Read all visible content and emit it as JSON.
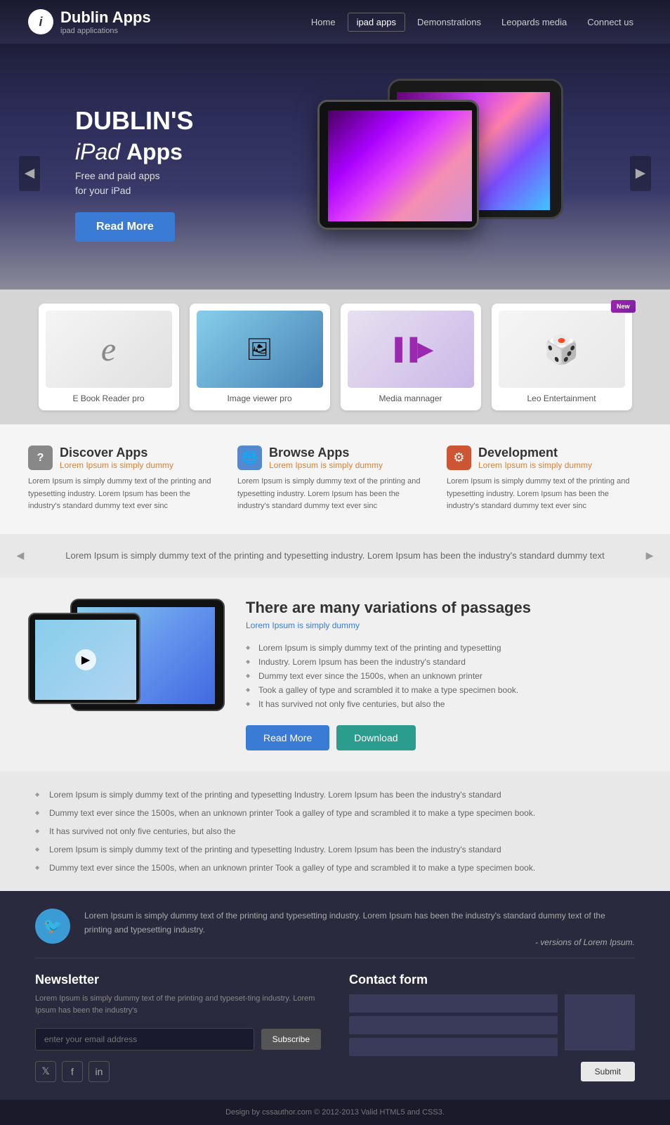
{
  "header": {
    "logo_icon": "i",
    "logo_title": "Dublin Apps",
    "logo_subtitle": "ipad applications",
    "nav": {
      "home": "Home",
      "ipad_apps": "ipad apps",
      "demonstrations": "Demonstrations",
      "leopards_media": "Leopards media",
      "connect_us": "Connect us"
    }
  },
  "hero": {
    "title_line1": "DUBLIN'S",
    "title_line2_italic": "iPad",
    "title_line2_bold": "Apps",
    "description": "Free and paid apps\nfor your iPad",
    "read_more": "Read More",
    "arrow_left": "◄",
    "arrow_right": "►"
  },
  "apps": [
    {
      "name": "E Book Reader pro",
      "type": "ebook"
    },
    {
      "name": "Image viewer pro",
      "type": "image"
    },
    {
      "name": "Media mannager",
      "type": "media"
    },
    {
      "name": "Leo Entertainment",
      "type": "leo",
      "badge": "New"
    }
  ],
  "features": [
    {
      "icon": "?",
      "title": "Discover Apps",
      "subtitle": "Lorem Ipsum is simply dummy",
      "text": "Lorem Ipsum is simply dummy text of the printing and typesetting industry. Lorem Ipsum has been the industry's standard dummy text ever sinc"
    },
    {
      "icon": "🌐",
      "title": "Browse Apps",
      "subtitle": "Lorem Ipsum is simply dummy",
      "text": "Lorem Ipsum is simply dummy text of the printing and typesetting industry. Lorem Ipsum has been the industry's standard dummy text ever sinc"
    },
    {
      "icon": "⚙",
      "title": "Development",
      "subtitle": "Lorem Ipsum is simply dummy",
      "text": "Lorem Ipsum is simply dummy text of the printing and typesetting industry. Lorem Ipsum has been the industry's standard dummy text ever sinc"
    }
  ],
  "testimonial": {
    "text": "Lorem Ipsum is simply dummy text of the printing and typesetting industry.\nLorem Ipsum has been the industry's standard dummy text"
  },
  "content": {
    "title": "There are many variations of passages",
    "subtitle": "Lorem Ipsum is simply dummy",
    "list": [
      "Lorem Ipsum is simply dummy text of the printing and typesetting",
      "Industry. Lorem Ipsum has been the industry's standard",
      "Dummy text ever since the 1500s, when an unknown printer",
      "Took a galley of type and scrambled it to make a type specimen book.",
      "It has survived not only five centuries, but also the"
    ],
    "read_more": "Read More",
    "download": "Download"
  },
  "bottom_list": [
    "Lorem Ipsum is simply dummy text of the printing and typesetting Industry. Lorem Ipsum has been the industry's standard",
    "Dummy text ever since the 1500s, when an unknown printer Took a galley of type and scrambled it to make a type specimen book.",
    "It has survived not only five centuries, but also the",
    "Lorem Ipsum is simply dummy text of the printing and typesetting Industry. Lorem Ipsum has been the industry's standard",
    "Dummy text ever since the 1500s, when an unknown printer Took a galley of type and scrambled it to make a type specimen book."
  ],
  "footer": {
    "quote_text": "Lorem Ipsum is simply dummy text of the printing and typesetting industry. Lorem Ipsum has been the industry's standard dummy text  of the printing and typesetting industry.",
    "quote_author": "- versions of Lorem Ipsum.",
    "newsletter": {
      "title": "Newsletter",
      "description": "Lorem Ipsum is simply dummy text of the printing and typeset-ting industry. Lorem Ipsum has been the industry's",
      "input_placeholder": "enter your email address",
      "subscribe_btn": "Subscribe"
    },
    "contact": {
      "title": "Contact form",
      "input1_placeholder": "",
      "input2_placeholder": "",
      "input3_placeholder": "",
      "submit_btn": "Submit"
    },
    "social": {
      "twitter": "𝕏",
      "facebook": "f",
      "linkedin": "in"
    },
    "credit": "Design by cssauthor.com © 2012-2013  Valid HTML5 and CSS3."
  }
}
